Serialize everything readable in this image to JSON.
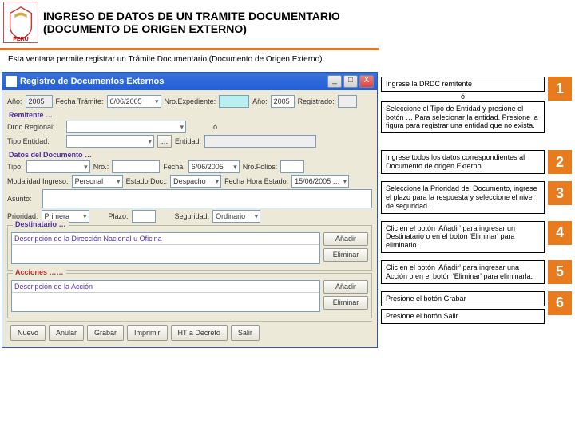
{
  "header": {
    "emblem_text": "PERÚ",
    "title1": "INGRESO DE DATOS DE UN TRAMITE DOCUMENTARIO",
    "title2": "(DOCUMENTO DE ORIGEN EXTERNO)",
    "subhead": "Esta ventana permite registrar un Trámite Documentario (Documento de Origen Externo)."
  },
  "window": {
    "title": "Registro de Documentos Externos",
    "btn_min": "_",
    "btn_max": "□",
    "btn_close": "X"
  },
  "form": {
    "ano_label": "Año:",
    "ano_value": "2005",
    "fecha_tramite_label": "Fecha Trámite:",
    "fecha_tramite_value": "6/06/2005",
    "nro_exp_label": "Nro.Expediente:",
    "nro_exp_value": "",
    "ano2_label": "Año:",
    "ano2_value": "2005",
    "registrado_label": "Registrado:",
    "section_remitente": "Remitente …",
    "drdc_label": "Drdc Regional:",
    "drdc_value": "",
    "o_label": "ó",
    "tipo_entidad_label": "Tipo Entidad:",
    "tipo_entidad_value": "",
    "dots": "…",
    "entidad_label": "Entidad:",
    "entidad_value": "",
    "section_datos": "Datos del Documento …",
    "tipo_label": "Tipo:",
    "nro_doc_label": "Nro.:",
    "fecha_doc_label": "Fecha:",
    "fecha_doc_value": "6/06/2005",
    "nro_folios_label": "Nro.Folios:",
    "modalidad_label": "Modalidad Ingreso:",
    "modalidad_value": "Personal",
    "estado_label": "Estado Doc.:",
    "estado_value": "Despacho",
    "fecha_hora_label": "Fecha Hora Estado:",
    "fecha_hora_value": "15/06/2005 …",
    "asunto_label": "Asunto:",
    "prioridad_label": "Prioridad:",
    "prioridad_value": "Primera",
    "plazo_label": "Plazo:",
    "seguridad_label": "Seguridad:",
    "seguridad_value": "Ordinario",
    "dest_title": "Destinatario …",
    "dest_list_header": "Descripción de la Dirección Nacional u Oficina",
    "acc_title": "Acciones ……",
    "acc_list_header": "Descripción de la Acción",
    "btn_anadir": "Añadir",
    "btn_eliminar": "Eliminar"
  },
  "toolbar": {
    "nuevo": "Nuevo",
    "anular": "Anular",
    "grabar": "Grabar",
    "imprimir": "Imprimir",
    "ht": "HT a Decreto",
    "salir": "Salir"
  },
  "instructions": [
    {
      "num": "1",
      "parts": [
        "Ingrese la DRDC remitente",
        "ó",
        "Seleccione el Tipo de Entidad y presione el botón … Para selecionar la entidad. Presione la figura para registrar una entidad que no exista."
      ]
    },
    {
      "num": "2",
      "text": "Ingrese todos los datos correspondientes al Documento de origen Externo"
    },
    {
      "num": "3",
      "text": "Seleccione la Prioridad del Documento, ingrese el plazo para la respuesta y seleccione el nivel de seguridad."
    },
    {
      "num": "4",
      "text": "Clic en el botón 'Añadir' para ingresar un Destinatario o en el botón 'Eliminar' para eliminarlo."
    },
    {
      "num": "5",
      "text": "Clic en el botón 'Añadir' para ingresar una Acción o en el botón 'Eliminar' para eliminarla."
    },
    {
      "num": "6",
      "parts": [
        "Presione el botón Grabar",
        "Presione el botón Salir"
      ]
    }
  ]
}
